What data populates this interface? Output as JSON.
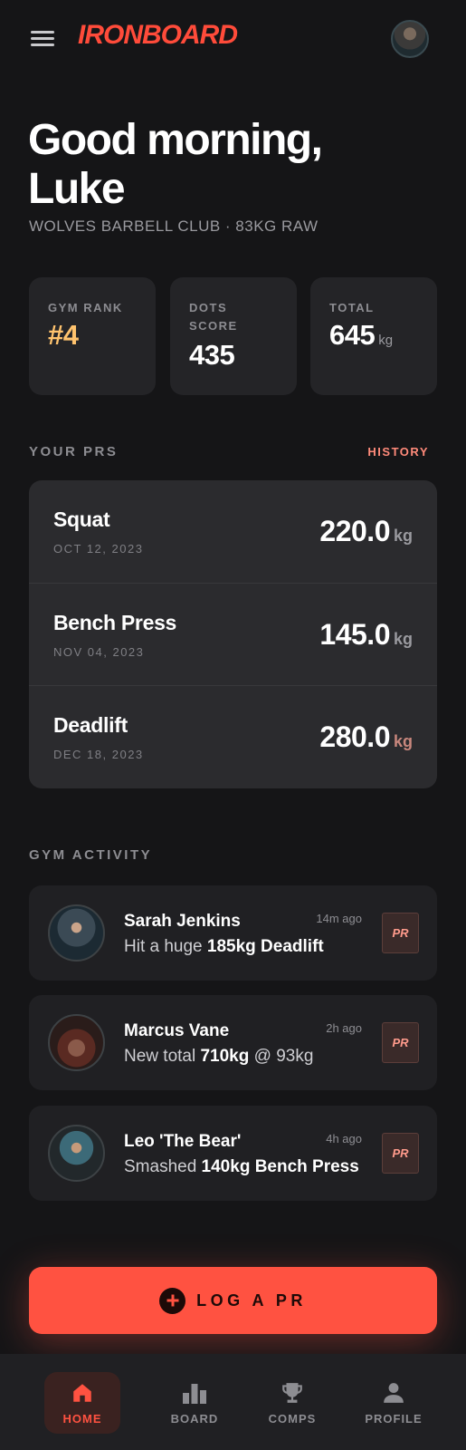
{
  "header": {
    "logo": "IRONBOARD",
    "menu_icon": "hamburger-menu-icon",
    "avatar_icon": "user-avatar"
  },
  "greeting": {
    "line1": "Good morning,",
    "line2": "Luke",
    "subtitle": "WOLVES BARBELL CLUB · 83KG RAW"
  },
  "stats": [
    {
      "label": "GYM RANK",
      "value": "#4",
      "unit": "",
      "color": "#ffc36e"
    },
    {
      "label": "DOTS SCORE",
      "value": "435",
      "unit": "",
      "color": "#ffffff"
    },
    {
      "label": "TOTAL",
      "value": "645",
      "unit": "kg",
      "color": "#ffffff"
    }
  ],
  "prs": {
    "title": "YOUR PRS",
    "history_label": "HISTORY",
    "items": [
      {
        "lift": "Squat",
        "date": "OCT 12, 2023",
        "value": "220.0",
        "unit": "kg"
      },
      {
        "lift": "Bench Press",
        "date": "NOV 04, 2023",
        "value": "145.0",
        "unit": "kg"
      },
      {
        "lift": "Deadlift",
        "date": "DEC 18, 2023",
        "value": "280.0",
        "unit": "kg"
      }
    ]
  },
  "activity": {
    "title": "GYM ACTIVITY",
    "items": [
      {
        "name": "Sarah Jenkins",
        "time": "14m ago",
        "text_pre": "Hit a huge ",
        "text_bold": "185kg Deadlift",
        "text_post": "",
        "badge": "PR"
      },
      {
        "name": "Marcus Vane",
        "time": "2h ago",
        "text_pre": "New total ",
        "text_bold": "710kg",
        "text_post": " @ 93kg",
        "badge": "PR"
      },
      {
        "name": "Leo 'The Bear'",
        "time": "4h ago",
        "text_pre": "Smashed ",
        "text_bold": "140kg Bench Press",
        "text_post": "",
        "badge": "PR"
      }
    ]
  },
  "cta": {
    "label": "LOG A PR",
    "icon": "plus-circle-icon"
  },
  "nav": {
    "items": [
      {
        "label": "HOME",
        "icon": "home-icon",
        "active": true
      },
      {
        "label": "BOARD",
        "icon": "bar-chart-icon",
        "active": false
      },
      {
        "label": "COMPS",
        "icon": "trophy-icon",
        "active": false
      },
      {
        "label": "PROFILE",
        "icon": "person-icon",
        "active": false
      }
    ]
  },
  "colors": {
    "background": "#151517",
    "accent": "#ff5241",
    "rank": "#ffc36e",
    "card": "#242427"
  }
}
